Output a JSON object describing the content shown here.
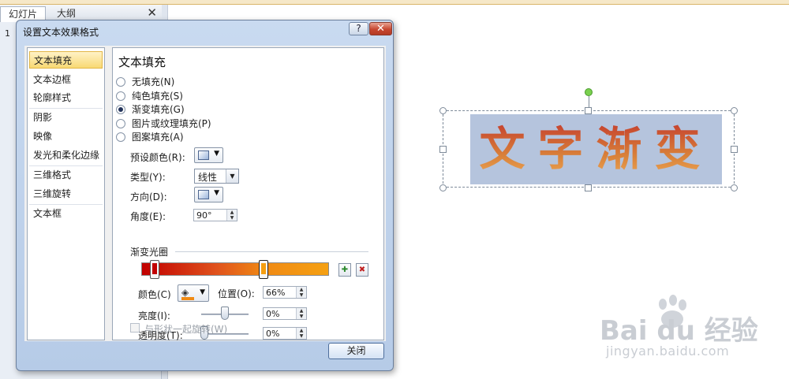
{
  "left_panel": {
    "tabs": [
      "幻灯片",
      "大纲"
    ],
    "close_glyph": "✕",
    "slide_number": "1"
  },
  "slide": {
    "wordart_text": "文字渐变"
  },
  "watermark": {
    "logo": "Bai  du 经验",
    "url": "jingyan.baidu.com"
  },
  "dialog": {
    "title": "设置文本效果格式",
    "help_glyph": "?",
    "close_glyph": "✕",
    "nav": {
      "items": [
        "文本填充",
        "文本边框",
        "轮廓样式",
        "阴影",
        "映像",
        "发光和柔化边缘",
        "三维格式",
        "三维旋转",
        "文本框"
      ],
      "selected": "文本填充"
    },
    "pane": {
      "title": "文本填充",
      "fill_options": [
        "无填充(N)",
        "纯色填充(S)",
        "渐变填充(G)",
        "图片或纹理填充(P)",
        "图案填充(A)"
      ],
      "selected_fill": "渐变填充(G)",
      "preset_colors_label": "预设颜色(R):",
      "type_label": "类型(Y):",
      "type_value": "线性",
      "direction_label": "方向(D):",
      "angle_label": "角度(E):",
      "angle_value": "90°",
      "gradient_stops_label": "渐变光圈",
      "stop_colors": [
        "#c10000",
        "#f59e10"
      ],
      "color_label": "颜色(C)",
      "fill_color": "#f08a14",
      "position_label": "位置(O):",
      "position_value": "66%",
      "brightness_label": "亮度(I):",
      "brightness_value": "0%",
      "transparency_label": "透明度(T):",
      "transparency_value": "0%",
      "rotate_with_shape_label": "与形状一起旋转(W)"
    },
    "close_button": "关闭"
  }
}
